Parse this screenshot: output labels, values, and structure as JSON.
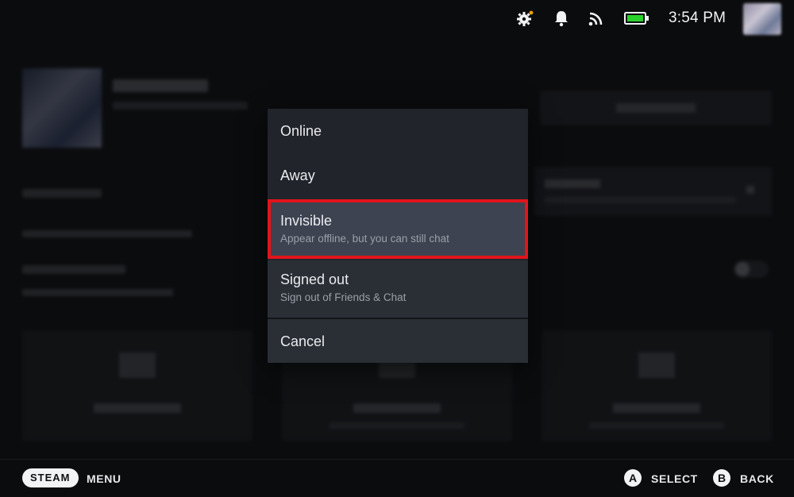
{
  "status_bar": {
    "settings_icon": "gear-icon",
    "notification_icon": "bell-icon",
    "network_icon": "wifi-signal-icon",
    "battery_icon": "battery-icon",
    "battery_color": "#2bd12b",
    "time": "3:54 PM"
  },
  "status_menu": {
    "options": [
      {
        "label": "Online",
        "sub": ""
      },
      {
        "label": "Away",
        "sub": ""
      },
      {
        "label": "Invisible",
        "sub": "Appear offline, but you can still chat"
      },
      {
        "label": "Signed out",
        "sub": "Sign out of Friends & Chat"
      }
    ],
    "cancel_label": "Cancel",
    "focused": "Invisible",
    "highlight_color": "#e2141c"
  },
  "footer": {
    "steam_label": "STEAM",
    "menu_label": "MENU",
    "select_button": "A",
    "select_label": "SELECT",
    "back_button": "B",
    "back_label": "BACK"
  }
}
